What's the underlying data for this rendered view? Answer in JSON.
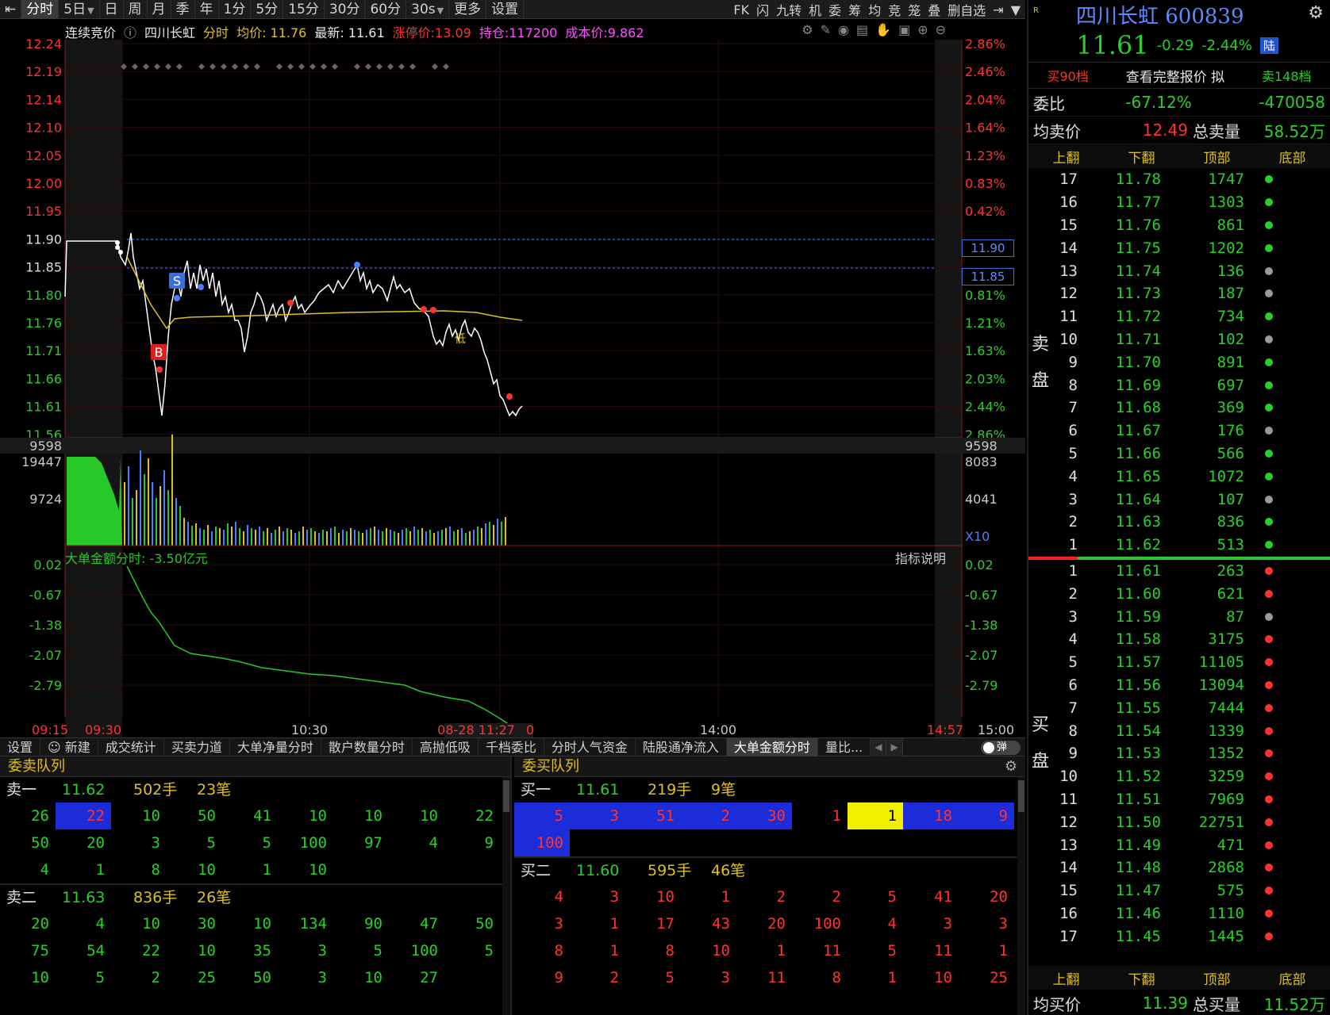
{
  "toolbar": {
    "items": [
      "分时",
      "5日",
      "日",
      "周",
      "月",
      "季",
      "年",
      "1分",
      "5分",
      "15分",
      "30分",
      "60分",
      "30s",
      "更多",
      "设置"
    ],
    "right_items": [
      "FK",
      "闪",
      "九转",
      "机",
      "委",
      "筹",
      "均",
      "竞",
      "笼",
      "叠",
      "删自选"
    ]
  },
  "info_bar": {
    "auction": "连续竞价",
    "stock": "四川长虹",
    "mode": "分时",
    "avg_price": "均价: 11.76",
    "latest": "最新: 11.61",
    "limit_up": "涨停价:13.09",
    "position": "持仓:117200",
    "cost": "成本价:9.862"
  },
  "chart": {
    "price_ticks": [
      "12.24",
      "12.19",
      "12.14",
      "12.10",
      "12.05",
      "12.00",
      "11.95",
      "11.90",
      "11.85",
      "11.80",
      "11.76",
      "11.71",
      "11.66",
      "11.61",
      "11.56"
    ],
    "pct_ticks": [
      "2.86%",
      "2.46%",
      "2.04%",
      "1.64%",
      "1.23%",
      "0.83%",
      "0.42%",
      "",
      "",
      "0.81%",
      "1.21%",
      "1.63%",
      "2.03%",
      "2.44%",
      "2.86%"
    ],
    "price_box_1": "11.90",
    "price_box_2": "11.85",
    "vol_ticks_left": [
      "9598",
      "19447",
      "9724"
    ],
    "vol_ticks_right": [
      "9598",
      "8083",
      "4041",
      "X10"
    ],
    "lower_ticks_left": [
      "0.02",
      "-0.67",
      "-1.38",
      "-2.07",
      "-2.79"
    ],
    "lower_ticks_right": [
      "0.02",
      "-0.67",
      "-1.38",
      "-2.07",
      "-2.79"
    ],
    "lower_label": "大单金额分时: -3.50亿元",
    "indicator_note": "指标说明",
    "time_labels": [
      "09:15",
      "09:30",
      "10:30",
      "08-28 11:27",
      "0",
      "14:00",
      "14:57",
      "15:00"
    ],
    "marker_b": "B",
    "marker_s": "S",
    "marker_low": "低",
    "colors": {
      "price_line": "#ffffff",
      "avg_line": "#e0c020",
      "up": "#ff3232",
      "down": "#28d028"
    }
  },
  "tabs": [
    "设置",
    "新建",
    "成交统计",
    "买卖力道",
    "大单净量分时",
    "散户数量分时",
    "高抛低吸",
    "千档委比",
    "分时人气资金",
    "陆股通净流入",
    "大单金额分时",
    "量比..."
  ],
  "toggle_label": "弹",
  "sell_queue": {
    "title": "委卖队列",
    "levels": [
      {
        "label": "卖一",
        "price": "11.62",
        "vol": "502手",
        "count": "23笔",
        "rows": [
          [
            "26",
            "22",
            "10",
            "50",
            "41",
            "10",
            "10",
            "10",
            "22"
          ],
          [
            "50",
            "20",
            "3",
            "5",
            "5",
            "100",
            "97",
            "4",
            "9"
          ],
          [
            "4",
            "1",
            "8",
            "10",
            "1",
            "10",
            "",
            "",
            ""
          ]
        ]
      },
      {
        "label": "卖二",
        "price": "11.63",
        "vol": "836手",
        "count": "26笔",
        "rows": [
          [
            "20",
            "4",
            "10",
            "30",
            "10",
            "134",
            "90",
            "47",
            "50"
          ],
          [
            "75",
            "54",
            "22",
            "10",
            "35",
            "3",
            "5",
            "100",
            "5"
          ],
          [
            "10",
            "5",
            "2",
            "25",
            "50",
            "3",
            "10",
            "27",
            ""
          ]
        ]
      }
    ]
  },
  "buy_queue": {
    "title": "委买队列",
    "levels": [
      {
        "label": "买一",
        "price": "11.61",
        "vol": "219手",
        "count": "9笔",
        "rows": [
          [
            "5",
            "3",
            "51",
            "2",
            "30",
            "1",
            "1",
            "18",
            "9"
          ],
          [
            "100",
            "",
            "",
            "",
            "",
            "",
            "",
            "",
            ""
          ]
        ]
      },
      {
        "label": "买二",
        "price": "11.60",
        "vol": "595手",
        "count": "46笔",
        "rows": [
          [
            "4",
            "3",
            "10",
            "1",
            "2",
            "2",
            "5",
            "41",
            "20"
          ],
          [
            "3",
            "1",
            "17",
            "43",
            "20",
            "100",
            "4",
            "3",
            "3"
          ],
          [
            "8",
            "1",
            "8",
            "10",
            "1",
            "11",
            "5",
            "11",
            "1"
          ],
          [
            "9",
            "2",
            "5",
            "3",
            "11",
            "8",
            "1",
            "10",
            "25"
          ]
        ]
      }
    ]
  },
  "right": {
    "name": "四川长虹 600839",
    "last": "11.61",
    "change": "-0.29",
    "change_pct": "-2.44%",
    "market": "陆",
    "buy_levels": "买90档",
    "view_full": "查看完整报价",
    "sim": "拟",
    "sell_levels": "卖148档",
    "ratio_label": "委比",
    "ratio_pct": "-67.12%",
    "ratio_val": "-470058",
    "avg_sell_label": "均卖价",
    "avg_sell": "12.49",
    "total_sell_label": "总卖量",
    "total_sell": "58.52万",
    "nav": [
      "上翻",
      "下翻",
      "顶部",
      "底部"
    ],
    "sell_side": "卖盘",
    "buy_side": "买盘",
    "asks": [
      [
        "17",
        "11.78",
        "1747",
        "g"
      ],
      [
        "16",
        "11.77",
        "1303",
        "g"
      ],
      [
        "15",
        "11.76",
        "861",
        "g"
      ],
      [
        "14",
        "11.75",
        "1202",
        "g"
      ],
      [
        "13",
        "11.74",
        "136",
        "w"
      ],
      [
        "12",
        "11.73",
        "187",
        "w"
      ],
      [
        "11",
        "11.72",
        "734",
        "g"
      ],
      [
        "10",
        "11.71",
        "102",
        "w"
      ],
      [
        "9",
        "11.70",
        "891",
        "g"
      ],
      [
        "8",
        "11.69",
        "697",
        "g"
      ],
      [
        "7",
        "11.68",
        "369",
        "g"
      ],
      [
        "6",
        "11.67",
        "176",
        "w"
      ],
      [
        "5",
        "11.66",
        "566",
        "g"
      ],
      [
        "4",
        "11.65",
        "1072",
        "g"
      ],
      [
        "3",
        "11.64",
        "107",
        "w"
      ],
      [
        "2",
        "11.63",
        "836",
        "g"
      ],
      [
        "1",
        "11.62",
        "513",
        "g"
      ]
    ],
    "bids": [
      [
        "1",
        "11.61",
        "263",
        "r"
      ],
      [
        "2",
        "11.60",
        "621",
        "r"
      ],
      [
        "3",
        "11.59",
        "87",
        "w"
      ],
      [
        "4",
        "11.58",
        "3175",
        "r"
      ],
      [
        "5",
        "11.57",
        "11105",
        "r"
      ],
      [
        "6",
        "11.56",
        "13094",
        "r"
      ],
      [
        "7",
        "11.55",
        "7444",
        "r"
      ],
      [
        "8",
        "11.54",
        "1339",
        "r"
      ],
      [
        "9",
        "11.53",
        "1352",
        "r"
      ],
      [
        "10",
        "11.52",
        "3259",
        "r"
      ],
      [
        "11",
        "11.51",
        "7969",
        "r"
      ],
      [
        "12",
        "11.50",
        "22751",
        "r"
      ],
      [
        "13",
        "11.49",
        "471",
        "r"
      ],
      [
        "14",
        "11.48",
        "2868",
        "r"
      ],
      [
        "15",
        "11.47",
        "575",
        "r"
      ],
      [
        "16",
        "11.46",
        "1110",
        "r"
      ],
      [
        "17",
        "11.45",
        "1445",
        "r"
      ]
    ],
    "avg_buy_label": "均买价",
    "avg_buy": "11.39",
    "total_buy_label": "总买量",
    "total_buy": "11.52万"
  }
}
